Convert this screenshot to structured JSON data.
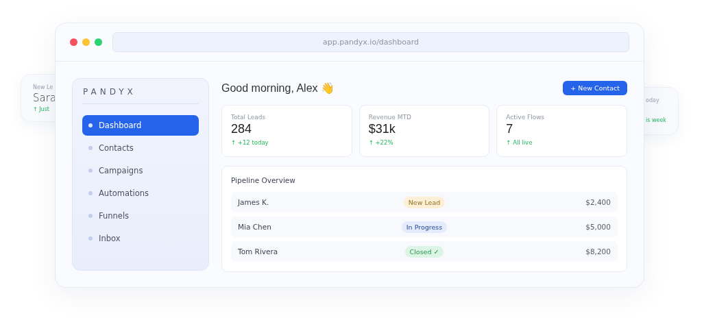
{
  "side_cards": [
    {
      "kind": "left",
      "label": "New Le",
      "value": "Sara",
      "note": "↑ Just"
    },
    {
      "kind": "right",
      "label": "oday",
      "note": "is week"
    }
  ],
  "window": {
    "url": "app.pandyx.io/dashboard"
  },
  "sidebar": {
    "logo": "PANDYX",
    "items": [
      {
        "label": "Dashboard",
        "selected": true
      },
      {
        "label": "Contacts",
        "selected": false
      },
      {
        "label": "Campaigns",
        "selected": false
      },
      {
        "label": "Automations",
        "selected": false
      },
      {
        "label": "Funnels",
        "selected": false
      },
      {
        "label": "Inbox",
        "selected": false
      }
    ]
  },
  "header": {
    "greeting": "Good morning, Alex 👋",
    "button": "+ New Contact"
  },
  "stats": [
    {
      "label": "Total Leads",
      "value": "284",
      "note": "↑ +12 today"
    },
    {
      "label": "Revenue MTD",
      "value": "$31k",
      "note": "↑ +22%"
    },
    {
      "label": "Active Flows",
      "value": "7",
      "note": "↑ All live"
    }
  ],
  "pipeline": {
    "title": "Pipeline Overview",
    "rows": [
      {
        "name": "James K.",
        "status": "New Lead",
        "color": "#fdf0d6",
        "amount": "$2,400"
      },
      {
        "name": "Mia Chen",
        "status": "In Progress",
        "color": "#e3ebfd",
        "amount": "$5,000"
      },
      {
        "name": "Tom Rivera",
        "status": "Closed ✓",
        "color": "#ddf5e5",
        "amount": "$8,200"
      }
    ]
  }
}
